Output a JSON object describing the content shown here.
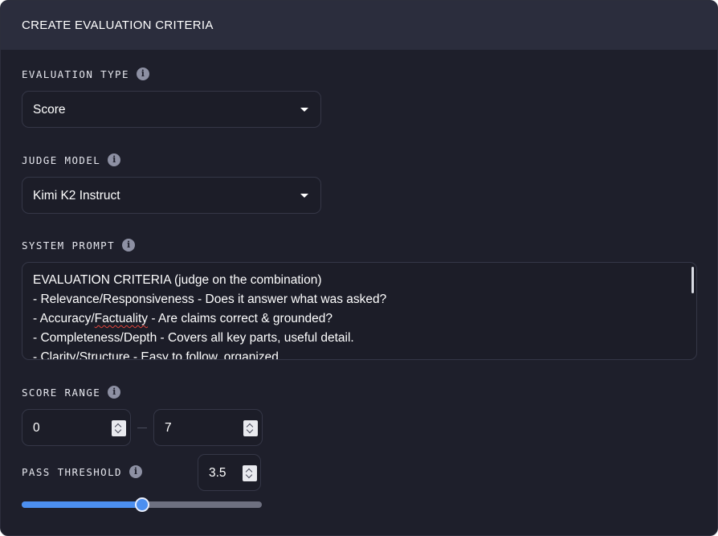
{
  "header": {
    "title": "CREATE EVALUATION CRITERIA"
  },
  "evaluation_type": {
    "label": "EVALUATION TYPE",
    "value": "Score"
  },
  "judge_model": {
    "label": "JUDGE MODEL",
    "value": "Kimi K2 Instruct"
  },
  "system_prompt": {
    "label": "SYSTEM PROMPT",
    "lines": [
      "EVALUATION CRITERIA (judge on the combination)",
      "- Relevance/Responsiveness - Does it answer what was asked?",
      "- Accuracy/Factuality - Are claims correct & grounded?",
      "- Completeness/Depth - Covers all key parts, useful detail.",
      "- Clarity/Structure - Easy to follow, organized."
    ],
    "line2_prefix": "- Accuracy/",
    "line2_misspelled": "Factuality",
    "line2_suffix": " - Are claims correct & grounded?"
  },
  "score_range": {
    "label": "SCORE RANGE",
    "min": "0",
    "max": "7"
  },
  "pass_threshold": {
    "label": "PASS THRESHOLD",
    "value": "3.5",
    "fraction": 0.5
  },
  "icons": {
    "info": "info-icon",
    "caret": "caret-down-icon",
    "spinner": "stepper-arrows-icon"
  },
  "colors": {
    "accent": "#4c8ff0",
    "panel": "#1e1f2b",
    "header": "#2b2d3d"
  }
}
